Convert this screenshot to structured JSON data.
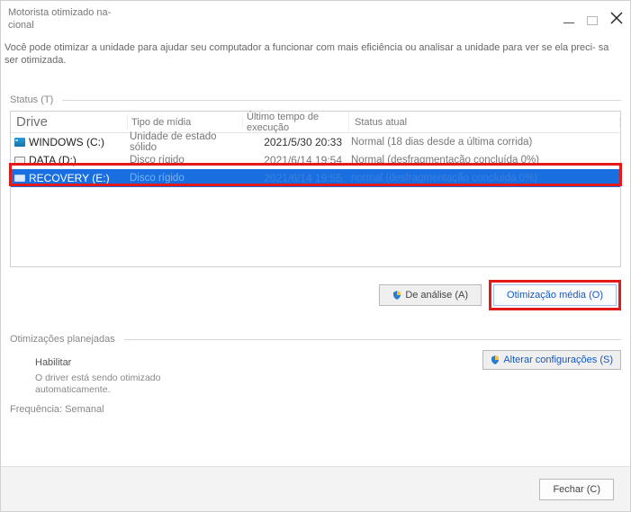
{
  "window": {
    "title": "Motorista otimizado na- cional",
    "description": "Você pode otimizar a unidade para ajudar seu computador a funcionar com mais eficiência ou analisar a unidade para ver se ela preci- sa ser otimizada."
  },
  "sections": {
    "status_label": "Status (T)",
    "scheduled_label": "Otimizações planejadas"
  },
  "table": {
    "headers": {
      "drive": "Drive",
      "media": "Tipo de mídia",
      "last": "Último tempo de execução",
      "status": "Status atual"
    },
    "rows": [
      {
        "name": "WINDOWS (C:)",
        "media": "Unidade de estado sólido",
        "last": "2021/5/30 20:33",
        "status": "Normal (18 dias desde a última corrida)"
      },
      {
        "name": "DATA (D:)",
        "media": "Disco rígido",
        "last": "2021/6/14 19:54",
        "status": "Normal (desfragmentação concluída 0%)"
      },
      {
        "name": "RECOVERY (E:)",
        "media": "Disco rígido",
        "last": "2021/6/14 19:55",
        "status": "normal (desfragmentação concluída 0%)"
      }
    ]
  },
  "buttons": {
    "analyze": "De   análise (A)",
    "optimize": "Otimização média (O)",
    "change_settings": "Alterar configurações (S)",
    "close": "Fechar (C)"
  },
  "schedule": {
    "enable": "Habilitar",
    "desc": "O driver está sendo otimizado automaticamente.",
    "frequency": "Frequência: Semanal"
  }
}
